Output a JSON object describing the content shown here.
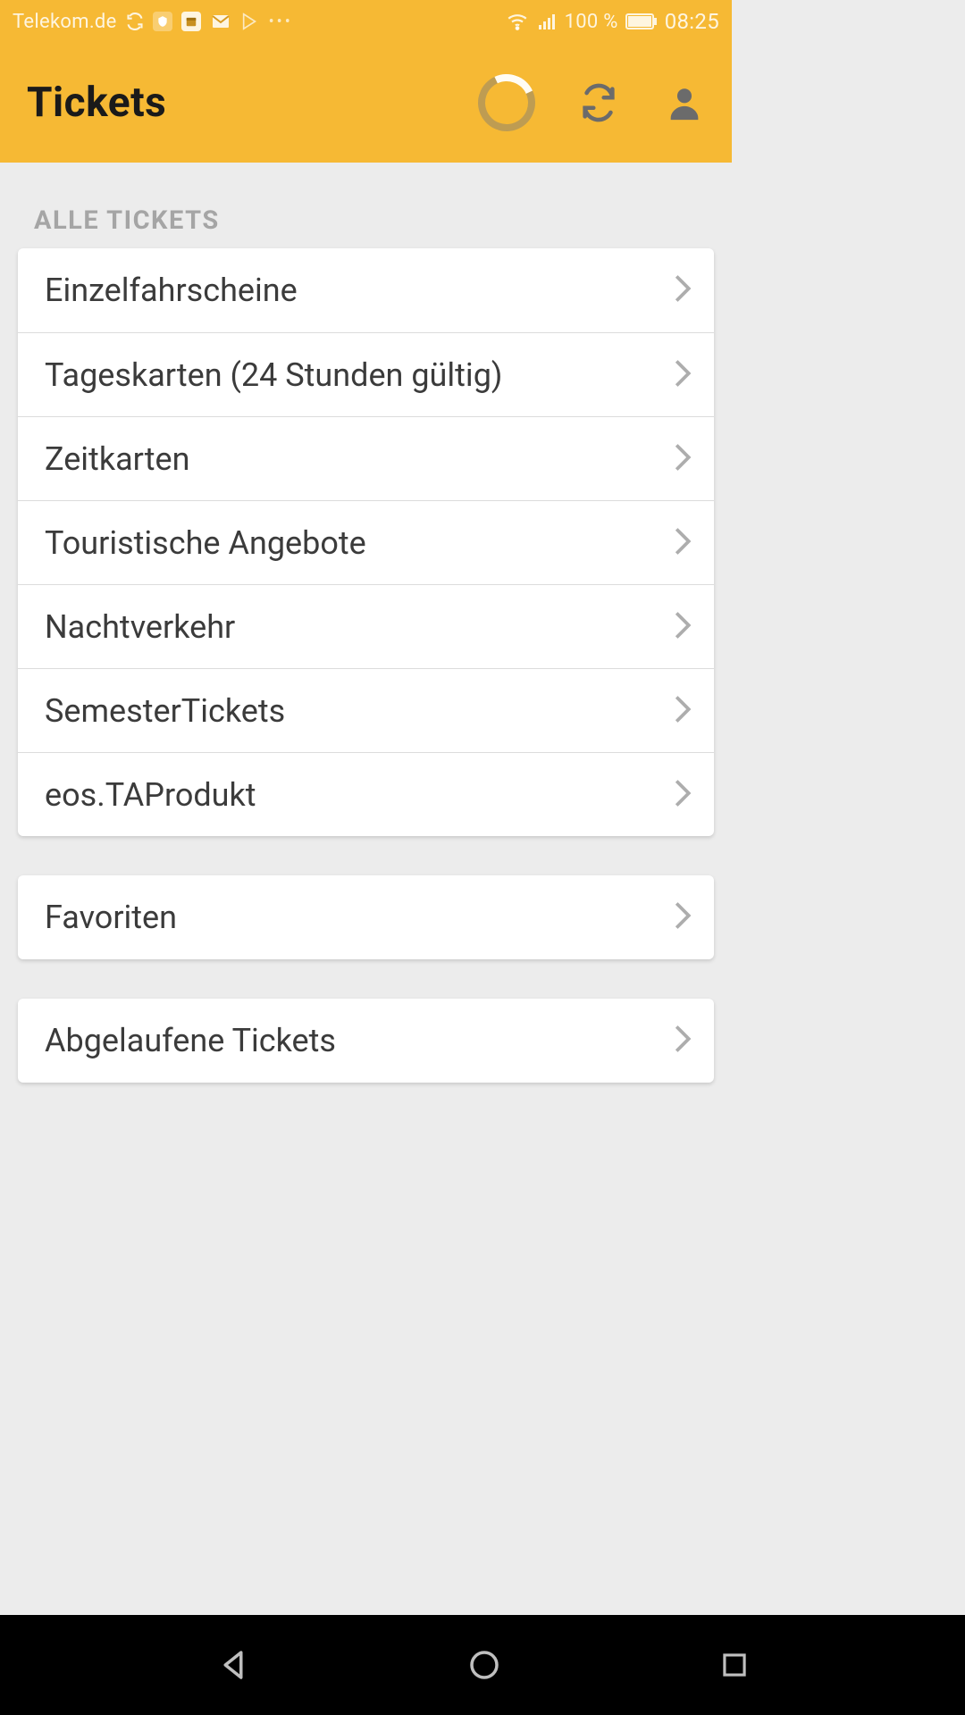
{
  "status_bar": {
    "carrier": "Telekom.de",
    "battery_pct": "100 %",
    "clock": "08:25"
  },
  "header": {
    "title": "Tickets"
  },
  "section_label": "ALLE TICKETS",
  "ticket_categories": [
    "Einzelfahrscheine",
    "Tageskarten (24 Stunden gültig)",
    "Zeitkarten",
    "Touristische Angebote",
    "Nachtverkehr",
    "SemesterTickets",
    "eos.TAProdukt"
  ],
  "favorites_label": "Favoriten",
  "expired_label": "Abgelaufene Tickets"
}
